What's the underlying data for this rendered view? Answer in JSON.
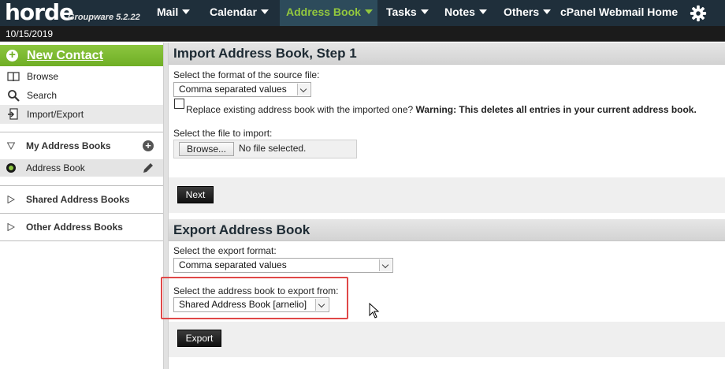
{
  "app": {
    "logo_text": "horde",
    "version": "Groupware 5.2.22",
    "date": "10/15/2019"
  },
  "nav": [
    {
      "label": "Mail"
    },
    {
      "label": "Calendar"
    },
    {
      "label": "Address Book"
    },
    {
      "label": "Tasks"
    },
    {
      "label": "Notes"
    },
    {
      "label": "Others"
    },
    {
      "label": "cPanel Webmail Home"
    }
  ],
  "icons": {
    "settings": "gear-icon",
    "browse": "book-icon",
    "search": "search-icon",
    "import_export": "import-export-icon"
  },
  "sidebar": {
    "new_contact": "New Contact",
    "links": [
      {
        "label": "Browse"
      },
      {
        "label": "Search"
      },
      {
        "label": "Import/Export"
      }
    ],
    "my_books_header": "My Address Books",
    "address_book": "Address Book",
    "shared_books_header": "Shared Address Books",
    "other_books_header": "Other Address Books"
  },
  "import": {
    "title": "Import Address Book, Step 1",
    "format_label": "Select the format of the source file:",
    "format_value": "Comma separated values",
    "replace_label": "Replace existing address book with the imported one?",
    "replace_warning": "Warning: This deletes all entries in your current address book.",
    "file_label": "Select the file to import:",
    "browse_button": "Browse...",
    "no_file": "No file selected.",
    "next_button": "Next"
  },
  "export": {
    "title": "Export Address Book",
    "format_label": "Select the export format:",
    "format_value": "Comma separated values",
    "source_label": "Select the address book to export from:",
    "source_value": "Shared Address Book [arnelio]",
    "export_button": "Export"
  },
  "colors": {
    "topbar": "#1f2f3b",
    "active_nav_text": "#93c83e",
    "new_contact_green": "#6fae25",
    "highlight_red": "#e04848"
  }
}
